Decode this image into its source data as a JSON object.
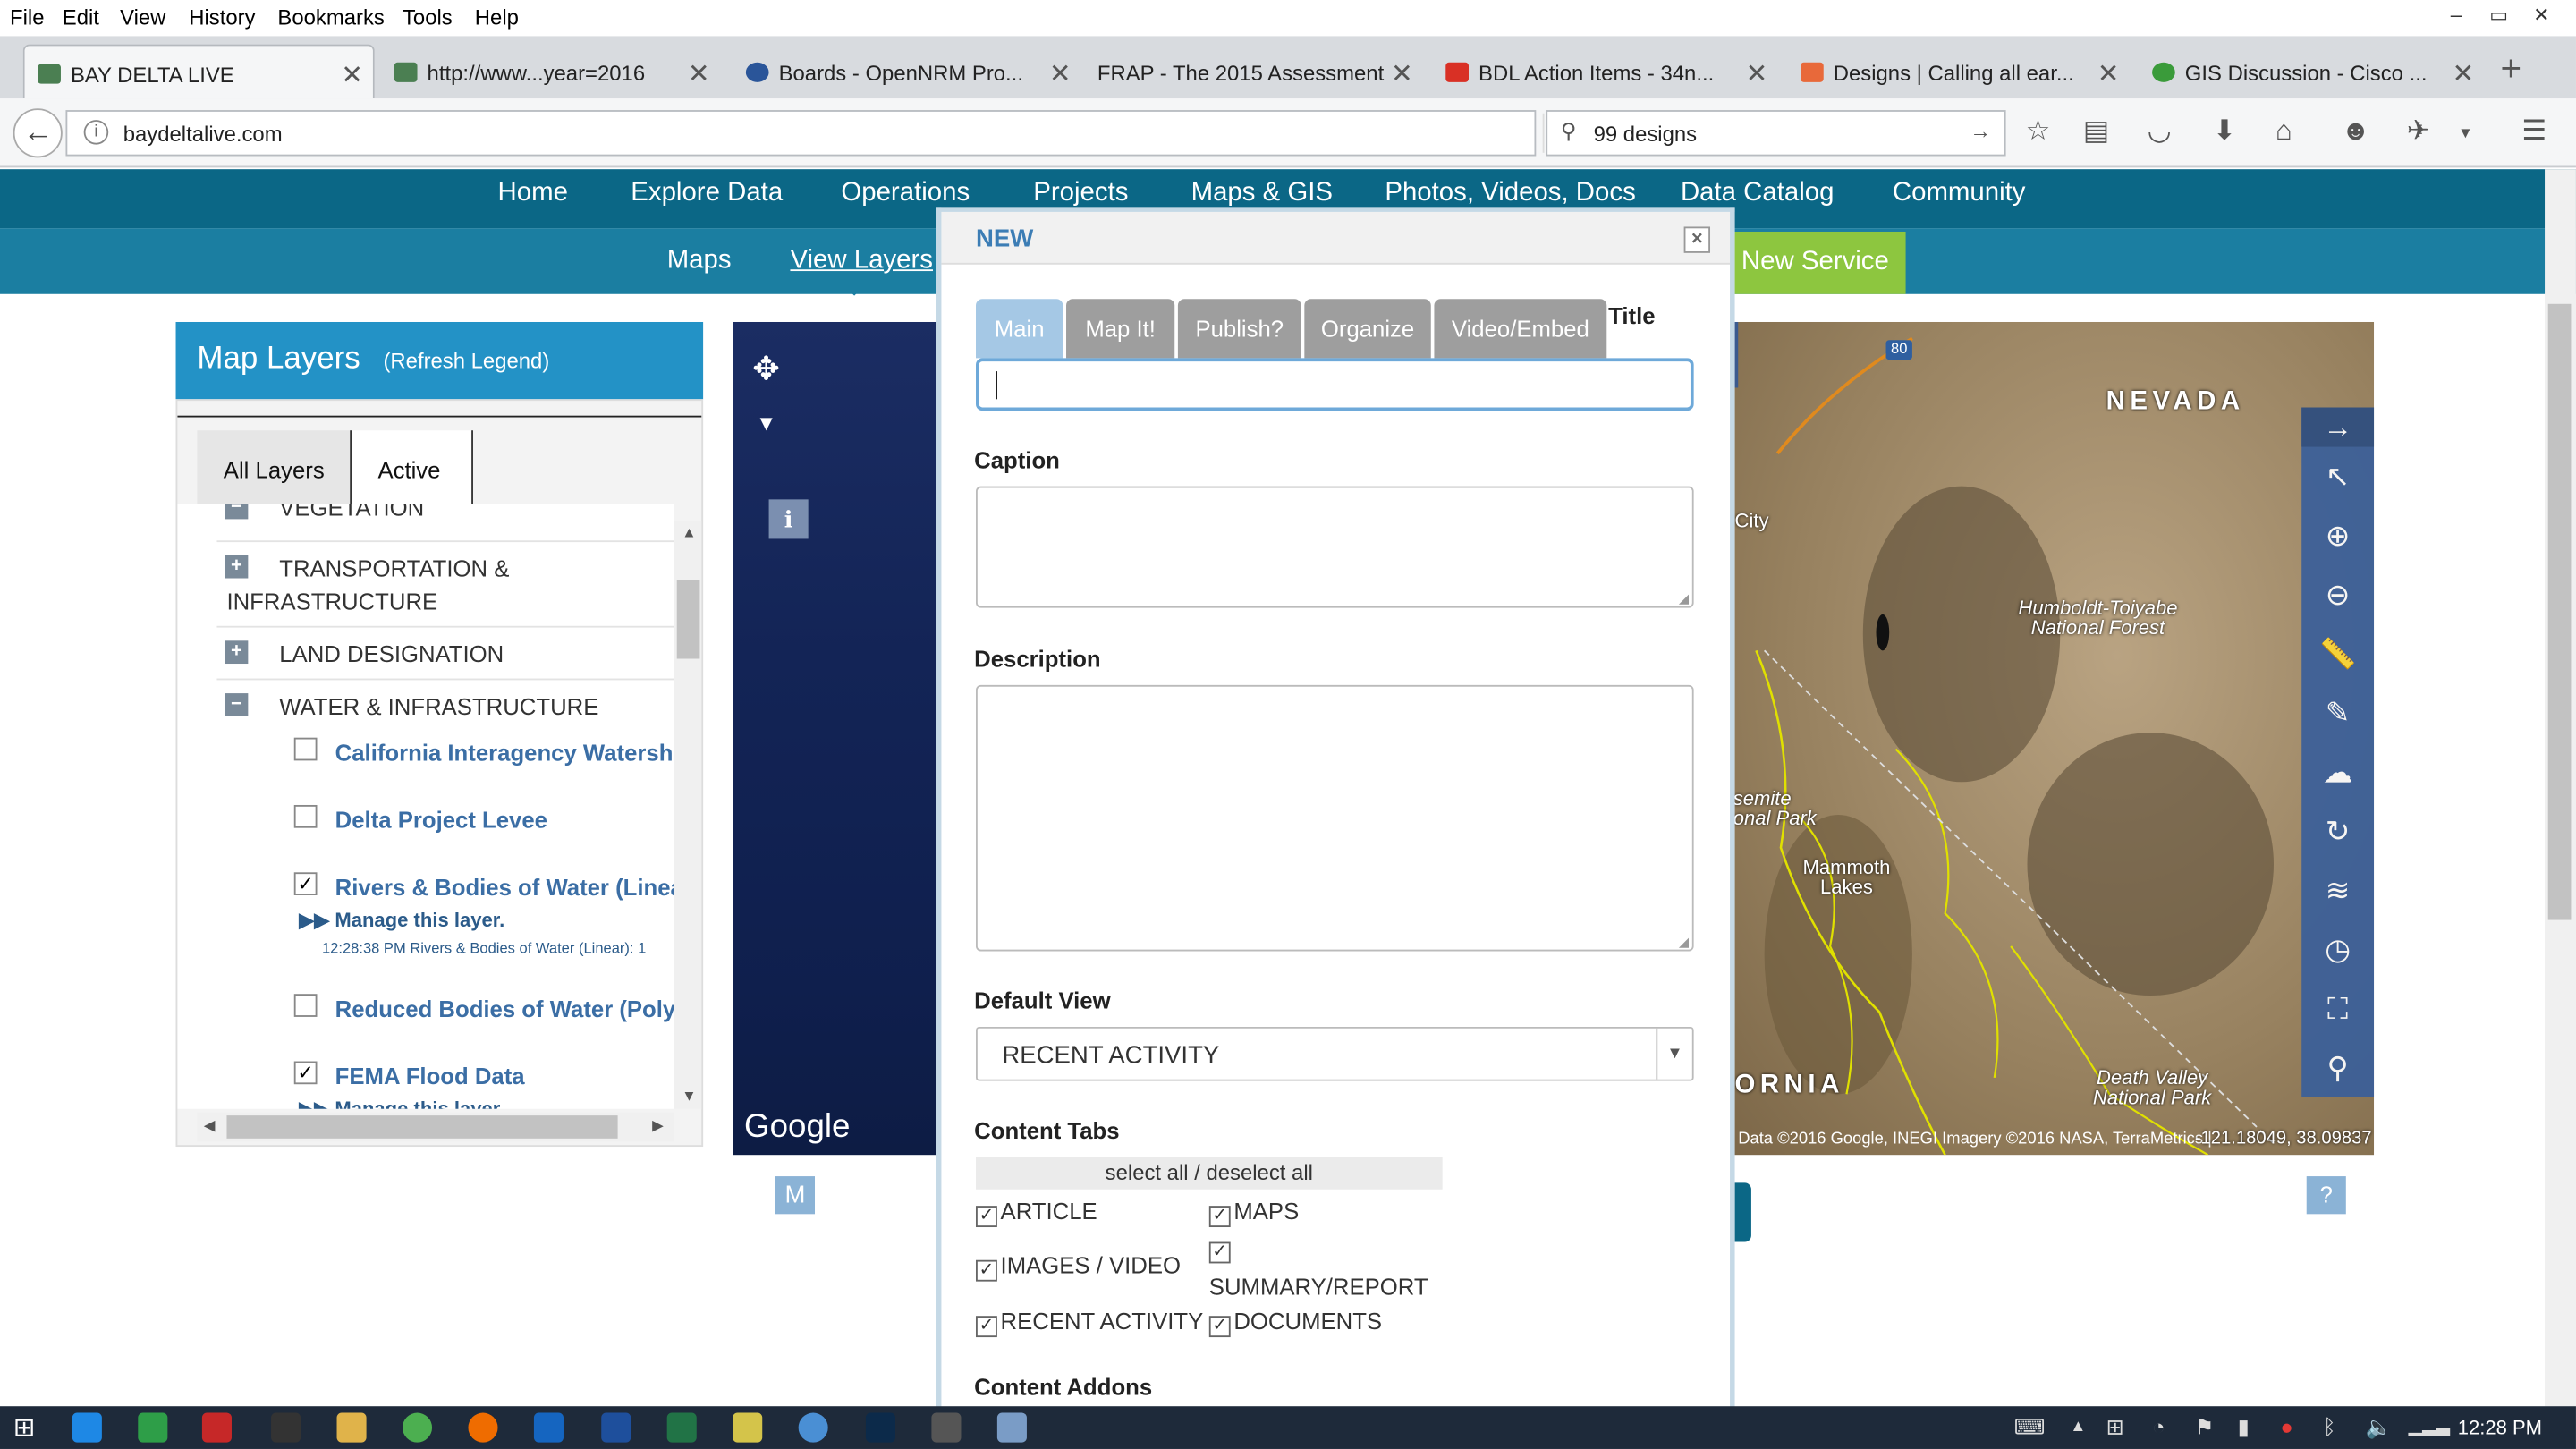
{
  "menubar": {
    "items": [
      "File",
      "Edit",
      "View",
      "History",
      "Bookmarks",
      "Tools",
      "Help"
    ]
  },
  "window_controls": [
    "–",
    "▭",
    "✕"
  ],
  "tabs": [
    {
      "label": "BAY DELTA LIVE",
      "active": true,
      "favicon": "bdl-icon"
    },
    {
      "label": "http://www...year=2016",
      "favicon": "bdl-icon"
    },
    {
      "label": "Boards - OpenNRM Pro...",
      "favicon": "board-icon"
    },
    {
      "label": "FRAP - The 2015 Assessment",
      "favicon": ""
    },
    {
      "label": "BDL Action Items - 34n...",
      "favicon": "gmail-icon"
    },
    {
      "label": "Designs | Calling all ear...",
      "favicon": "99-icon"
    },
    {
      "label": "GIS Discussion - Cisco ...",
      "favicon": "globe-icon"
    }
  ],
  "new_tab": "+",
  "address": {
    "url": "baydeltalive.com"
  },
  "search": {
    "value": "99 designs"
  },
  "site_nav": {
    "top": [
      "Home",
      "Explore Data",
      "Operations",
      "Projects",
      "Maps & GIS",
      "Photos, Videos, Docs",
      "Data Catalog",
      "Community"
    ],
    "sub": [
      "Maps",
      "View Layers"
    ],
    "new_service": "New Service"
  },
  "map_layers": {
    "title": "Map Layers",
    "refresh": "(Refresh Legend)",
    "tabs": [
      "All Layers",
      "Active"
    ],
    "groups": [
      {
        "label": "VEGETATION",
        "expanded": true
      },
      {
        "label": "TRANSPORTATION & INFRASTRUCTURE",
        "expanded": false
      },
      {
        "label": "LAND DESIGNATION",
        "expanded": false
      },
      {
        "label": "WATER & INFRASTRUCTURE",
        "expanded": true
      }
    ],
    "layers": [
      {
        "label": "California Interagency Watershe",
        "checked": false
      },
      {
        "label": "Delta Project Levee",
        "checked": false
      },
      {
        "label": "Rivers & Bodies of Water (Linear",
        "checked": true,
        "manage": "Manage this layer.",
        "status": "12:28:38 PM Rivers & Bodies of Water (Linear): 1"
      },
      {
        "label": "Reduced Bodies of Water (Polygo",
        "checked": false
      },
      {
        "label": "FEMA Flood Data",
        "checked": true,
        "manage": "Manage this layer."
      }
    ]
  },
  "map": {
    "google": "Google",
    "m_button": "M",
    "help_button": "?",
    "labels": {
      "nevada": "NEVADA",
      "city": "City",
      "humboldt": "Humboldt-Toiyabe National Forest",
      "yosemite": "semite onal Park",
      "mammoth": "Mammoth Lakes",
      "death_valley": "Death Valley National Park",
      "ornia": "ORNIA",
      "i80": "80"
    },
    "attribution": "Data ©2016 Google, INEGI Imagery ©2016 NASA, TerraMetrics | Terms of Use",
    "coords": "-121.18049, 38.09837"
  },
  "modal": {
    "title": "NEW",
    "close": "×",
    "tabs": [
      "Main",
      "Map It!",
      "Publish?",
      "Organize",
      "Video/Embed"
    ],
    "title_label": "Title",
    "caption_label": "Caption",
    "description_label": "Description",
    "default_view_label": "Default View",
    "default_view_value": "RECENT ACTIVITY",
    "content_tabs_label": "Content Tabs",
    "select_all": "select all / deselect all",
    "checks": [
      {
        "label": "ARTICLE",
        "checked": true
      },
      {
        "label": "MAPS",
        "checked": true
      },
      {
        "label": "IMAGES / VIDEO",
        "checked": true
      },
      {
        "label": "SUMMARY/REPORT",
        "checked": true
      },
      {
        "label": "RECENT ACTIVITY",
        "checked": true
      },
      {
        "label": "DOCUMENTS",
        "checked": true
      }
    ],
    "content_addons_label": "Content Addons"
  },
  "taskbar": {
    "time": "12:28 PM"
  },
  "colors": {
    "site_nav_dark": "#0b6786",
    "site_nav_light": "#1b7ea1",
    "accent_green": "#8dc63f",
    "panel_blue": "#2392c6"
  }
}
